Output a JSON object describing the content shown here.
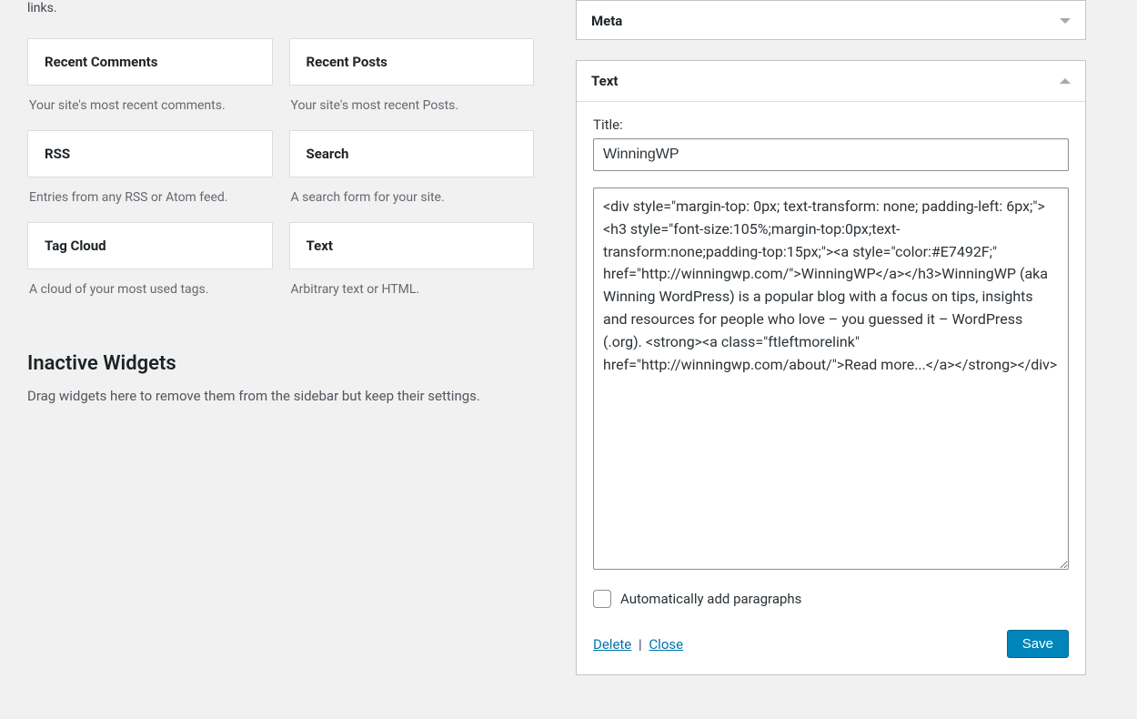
{
  "left": {
    "intro_fragment": "links.",
    "widgets": {
      "recent_comments": {
        "title": "Recent Comments",
        "desc": "Your site's most recent comments."
      },
      "recent_posts": {
        "title": "Recent Posts",
        "desc": "Your site's most recent Posts."
      },
      "rss": {
        "title": "RSS",
        "desc": "Entries from any RSS or Atom feed."
      },
      "search": {
        "title": "Search",
        "desc": "A search form for your site."
      },
      "tag_cloud": {
        "title": "Tag Cloud",
        "desc": "A cloud of your most used tags."
      },
      "text": {
        "title": "Text",
        "desc": "Arbitrary text or HTML."
      }
    },
    "inactive": {
      "heading": "Inactive Widgets",
      "desc": "Drag widgets here to remove them from the sidebar but keep their settings."
    }
  },
  "right": {
    "meta": {
      "title": "Meta"
    },
    "text": {
      "title": "Text",
      "title_label": "Title:",
      "title_value": "WinningWP",
      "content_value": "<div style=\"margin-top: 0px; text-transform: none; padding-left: 6px;\"><h3 style=\"font-size:105%;margin-top:0px;text-transform:none;padding-top:15px;\"><a style=\"color:#E7492F;\" href=\"http://winningwp.com/\">WinningWP</a></h3>WinningWP (aka Winning WordPress) is a popular blog with a focus on tips, insights and resources for people who love – you guessed it – WordPress (.org). <strong><a class=\"ftleftmorelink\" href=\"http://winningwp.com/about/\">Read more...</a></strong></div>",
      "autop_label": "Automatically add paragraphs",
      "delete_label": "Delete",
      "close_label": "Close",
      "save_label": "Save"
    }
  }
}
